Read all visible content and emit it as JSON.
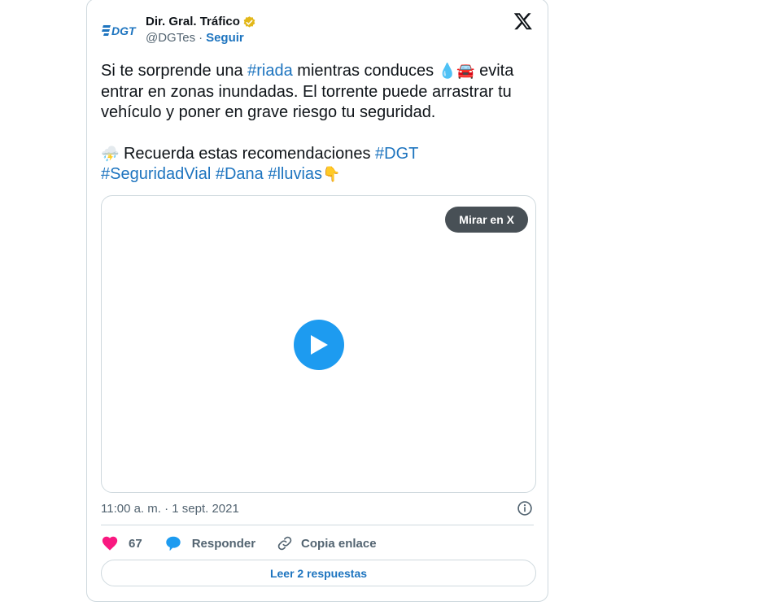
{
  "author": {
    "display_name": "Dir. Gral. Tráfico",
    "handle": "@DGTes",
    "separator": "·",
    "follow_label": "Seguir",
    "logo_text": "DGT",
    "verified_color": "#e2b719"
  },
  "tweet": {
    "line1_a": "Si te sorprende una ",
    "tag_riada": "#riada",
    "line1_b": " mientras conduces ",
    "line1_c": " evita entrar en zonas inundadas. El torrente puede arrastrar tu vehículo y poner en grave riesgo tu seguridad.",
    "emoji_drop": "💧",
    "emoji_car": "🚘",
    "emoji_storm": "⛈️",
    "line2_a": " Recuerda estas recomendaciones ",
    "tag_dgt": "#DGT",
    "tag_seguridad": "#SeguridadVial",
    "tag_dana": "#Dana",
    "tag_lluvias": "#lluvias",
    "emoji_point": "👇",
    "space": " "
  },
  "media": {
    "watch_label": "Mirar en X",
    "play_icon": "play-icon"
  },
  "meta": {
    "timestamp": "11:00 a. m. · 1 sept. 2021"
  },
  "actions": {
    "like_count": "67",
    "reply_label": "Responder",
    "copy_label": "Copia enlace"
  },
  "replies": {
    "label": "Leer 2 respuestas"
  },
  "colors": {
    "link": "#1d74bf",
    "like": "#f91880",
    "play": "#1d9bf0",
    "border": "#cfd9de"
  }
}
